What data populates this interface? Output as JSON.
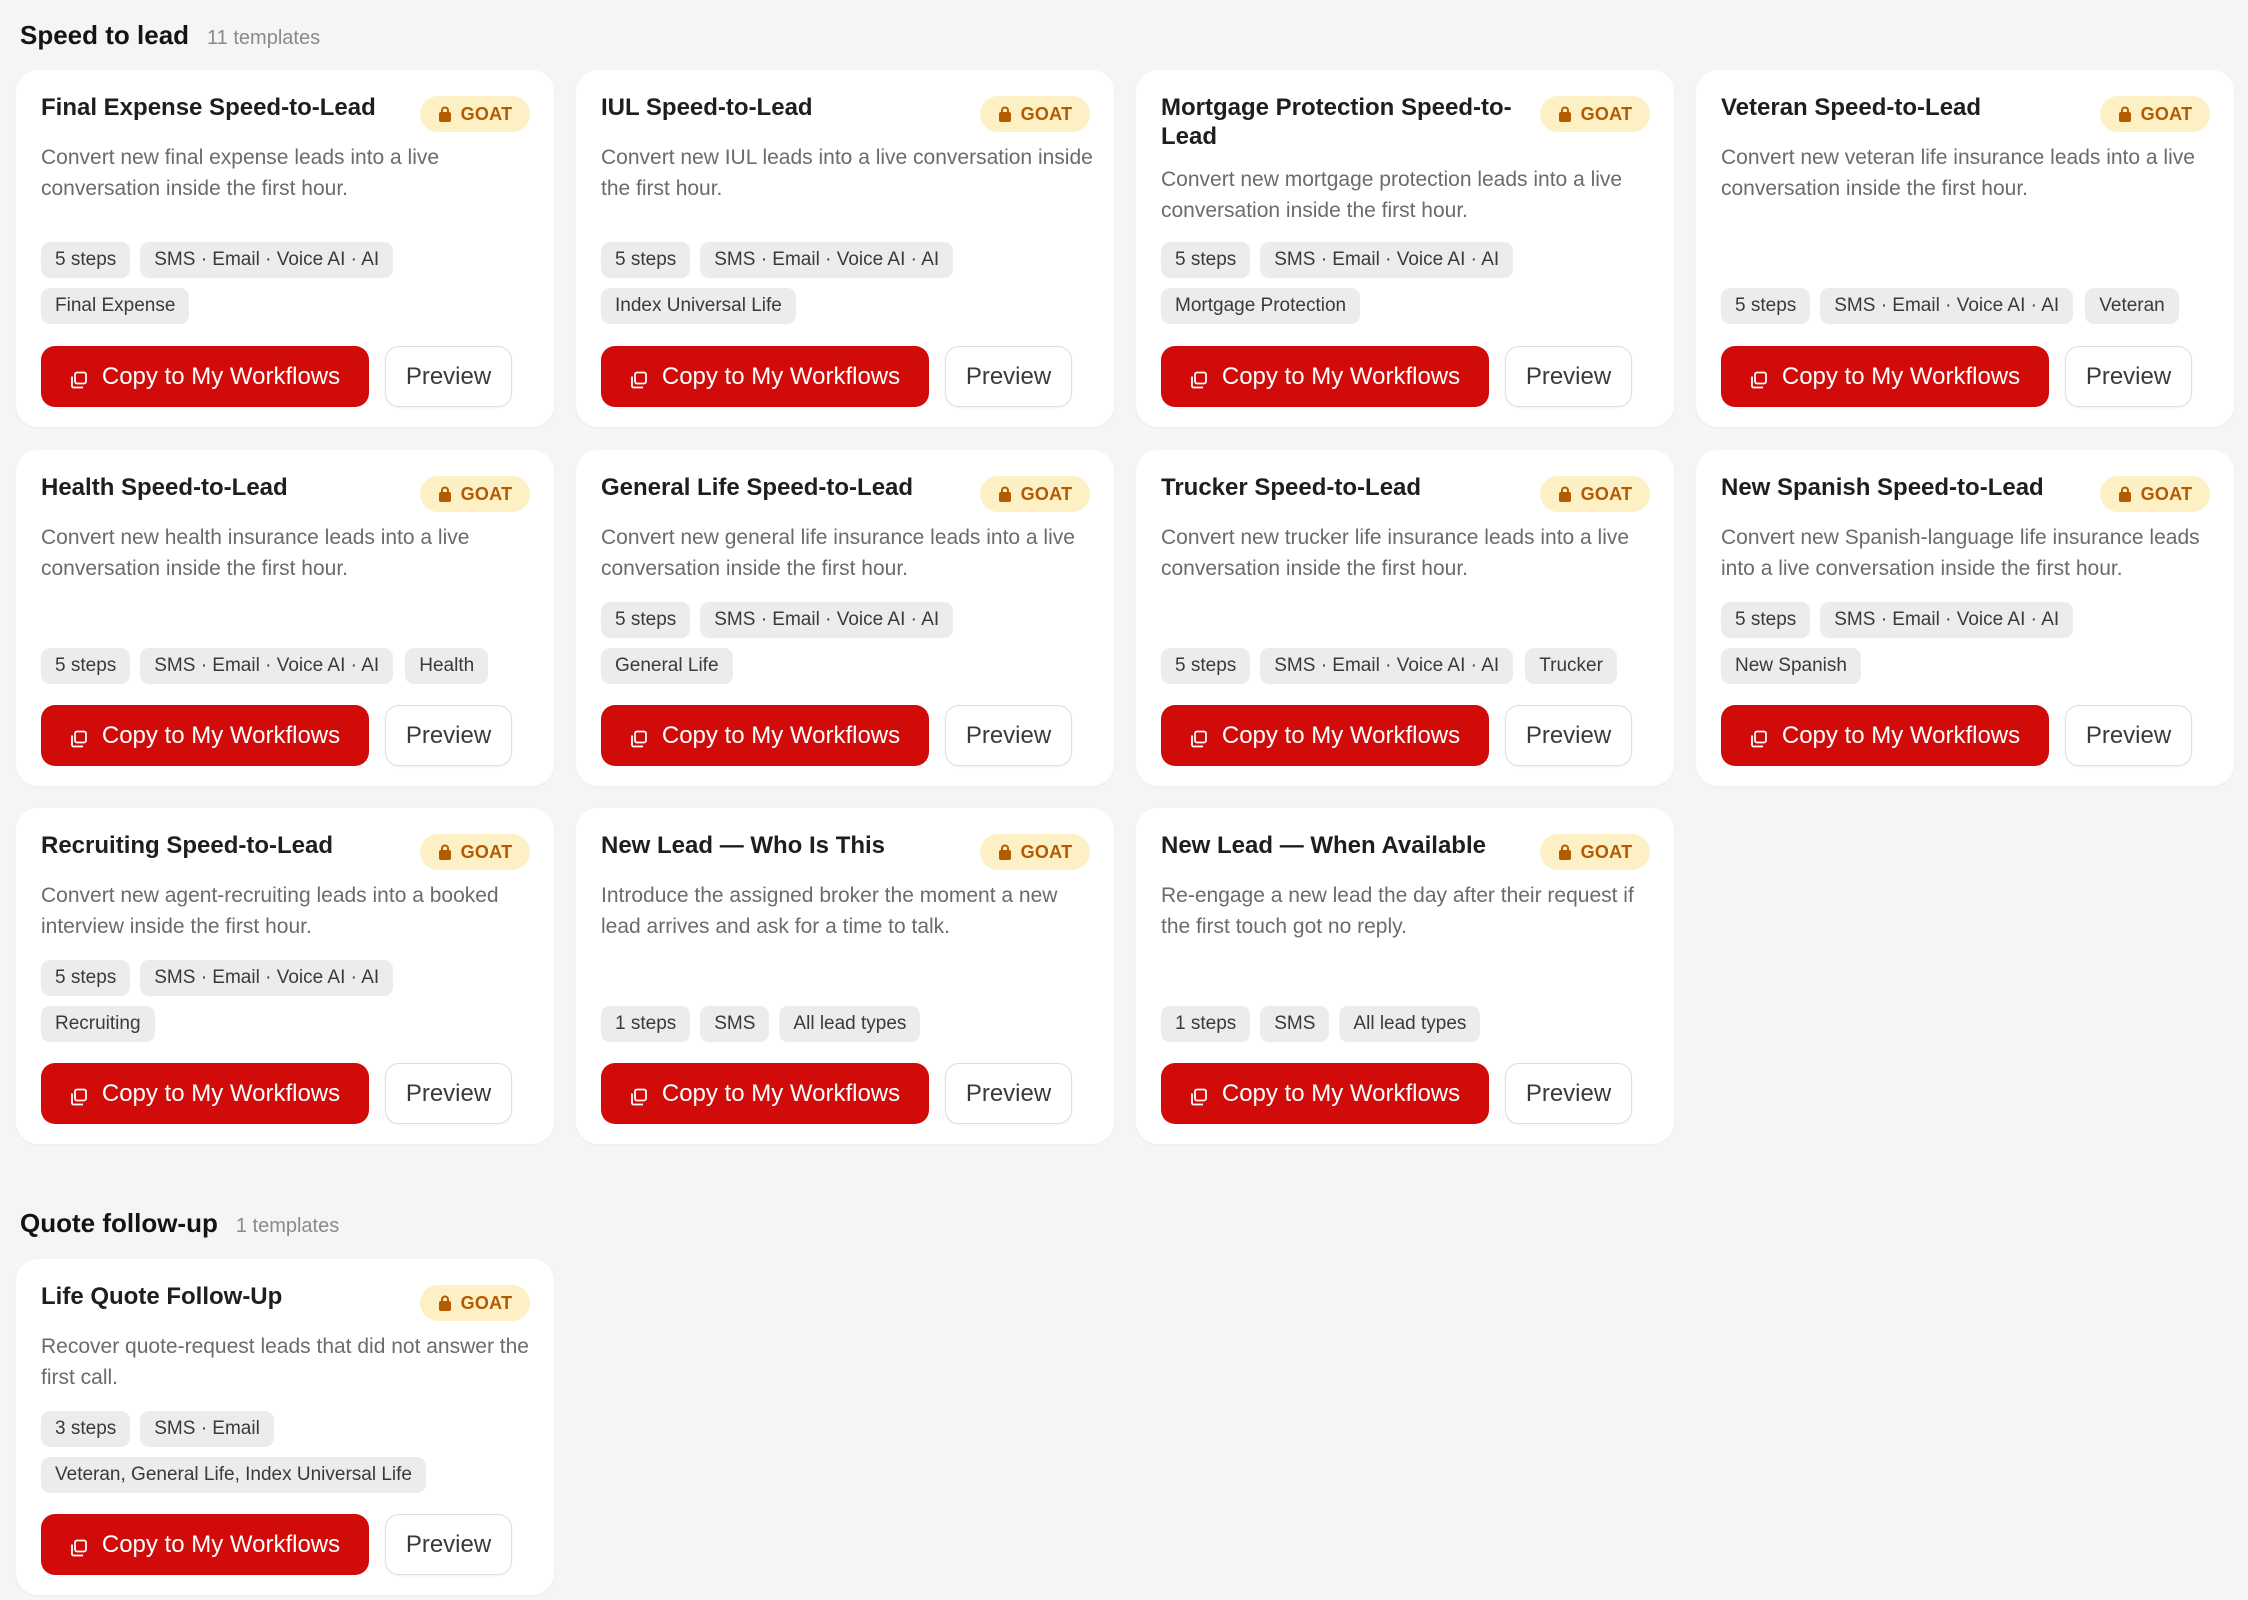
{
  "sections": [
    {
      "title": "Speed to lead",
      "count": "11 templates",
      "cards": [
        {
          "title": "Final Expense Speed-to-Lead",
          "badge": "GOAT",
          "description": "Convert new final expense leads into a live conversation inside the first hour.",
          "tags": [
            "5 steps",
            "SMS · Email · Voice AI · AI",
            "Final Expense"
          ],
          "copy_label": "Copy to My Workflows",
          "preview_label": "Preview"
        },
        {
          "title": "IUL Speed-to-Lead",
          "badge": "GOAT",
          "description": "Convert new IUL leads into a live conversation inside the first hour.",
          "tags": [
            "5 steps",
            "SMS · Email · Voice AI · AI",
            "Index Universal Life"
          ],
          "copy_label": "Copy to My Workflows",
          "preview_label": "Preview"
        },
        {
          "title": "Mortgage Protection Speed-to-Lead",
          "badge": "GOAT",
          "description": "Convert new mortgage protection leads into a live conversation inside the first hour.",
          "tags": [
            "5 steps",
            "SMS · Email · Voice AI · AI",
            "Mortgage Protection"
          ],
          "copy_label": "Copy to My Workflows",
          "preview_label": "Preview"
        },
        {
          "title": "Veteran Speed-to-Lead",
          "badge": "GOAT",
          "description": "Convert new veteran life insurance leads into a live conversation inside the first hour.",
          "tags": [
            "5 steps",
            "SMS · Email · Voice AI · AI",
            "Veteran"
          ],
          "copy_label": "Copy to My Workflows",
          "preview_label": "Preview"
        },
        {
          "title": "Health Speed-to-Lead",
          "badge": "GOAT",
          "description": "Convert new health insurance leads into a live conversation inside the first hour.",
          "tags": [
            "5 steps",
            "SMS · Email · Voice AI · AI",
            "Health"
          ],
          "copy_label": "Copy to My Workflows",
          "preview_label": "Preview"
        },
        {
          "title": "General Life Speed-to-Lead",
          "badge": "GOAT",
          "description": "Convert new general life insurance leads into a live conversation inside the first hour.",
          "tags": [
            "5 steps",
            "SMS · Email · Voice AI · AI",
            "General Life"
          ],
          "copy_label": "Copy to My Workflows",
          "preview_label": "Preview"
        },
        {
          "title": "Trucker Speed-to-Lead",
          "badge": "GOAT",
          "description": "Convert new trucker life insurance leads into a live conversation inside the first hour.",
          "tags": [
            "5 steps",
            "SMS · Email · Voice AI · AI",
            "Trucker"
          ],
          "copy_label": "Copy to My Workflows",
          "preview_label": "Preview"
        },
        {
          "title": "New Spanish Speed-to-Lead",
          "badge": "GOAT",
          "description": "Convert new Spanish-language life insurance leads into a live conversation inside the first hour.",
          "tags": [
            "5 steps",
            "SMS · Email · Voice AI · AI",
            "New Spanish"
          ],
          "copy_label": "Copy to My Workflows",
          "preview_label": "Preview"
        },
        {
          "title": "Recruiting Speed-to-Lead",
          "badge": "GOAT",
          "description": "Convert new agent-recruiting leads into a booked interview inside the first hour.",
          "tags": [
            "5 steps",
            "SMS · Email · Voice AI · AI",
            "Recruiting"
          ],
          "copy_label": "Copy to My Workflows",
          "preview_label": "Preview"
        },
        {
          "title": "New Lead — Who Is This",
          "badge": "GOAT",
          "description": "Introduce the assigned broker the moment a new lead arrives and ask for a time to talk.",
          "tags": [
            "1 steps",
            "SMS",
            "All lead types"
          ],
          "copy_label": "Copy to My Workflows",
          "preview_label": "Preview"
        },
        {
          "title": "New Lead — When Available",
          "badge": "GOAT",
          "description": "Re-engage a new lead the day after their request if the first touch got no reply.",
          "tags": [
            "1 steps",
            "SMS",
            "All lead types"
          ],
          "copy_label": "Copy to My Workflows",
          "preview_label": "Preview"
        }
      ]
    },
    {
      "title": "Quote follow-up",
      "count": "1 templates",
      "cards": [
        {
          "title": "Life Quote Follow-Up",
          "badge": "GOAT",
          "description": "Recover quote-request leads that did not answer the first call.",
          "tags": [
            "3 steps",
            "SMS · Email",
            "Veteran, General Life, Index Universal Life"
          ],
          "copy_label": "Copy to My Workflows",
          "preview_label": "Preview"
        }
      ]
    }
  ],
  "icons": {
    "badge": "lock-icon",
    "copy": "copy-icon"
  },
  "colors": {
    "accent": "#d10a0a",
    "badge_bg": "#fdf0c4",
    "badge_text": "#b45a00",
    "background": "#f5f5f5"
  }
}
